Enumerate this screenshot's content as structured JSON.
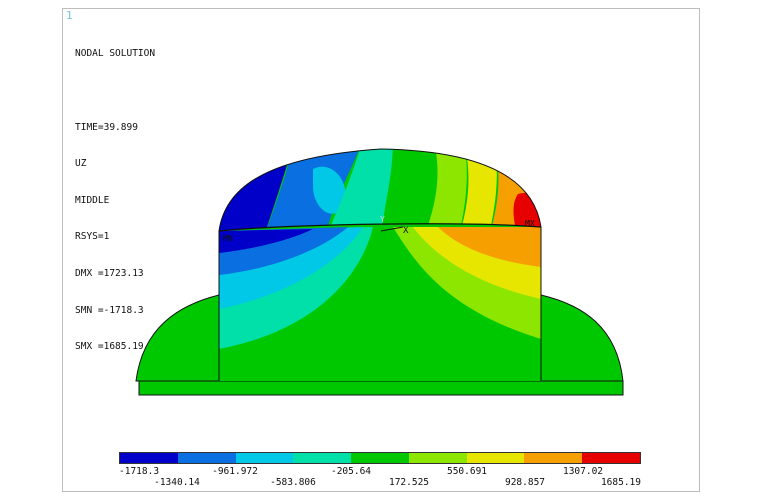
{
  "viewport": {
    "window_number": "1",
    "info_lines": [
      "NODAL SOLUTION",
      "",
      "TIME=39.899",
      "UZ",
      "MIDDLE",
      "RSYS=1",
      "DMX =1723.13",
      "SMN =-1718.3",
      "SMX =1685.19"
    ]
  },
  "model": {
    "markers": {
      "mn": "MN",
      "mx": "MX",
      "y_axis": "Y",
      "x_axis": "X"
    }
  },
  "legend": {
    "colors": [
      "#0000c8",
      "#0a6fe0",
      "#00c8e6",
      "#00e0a8",
      "#00c800",
      "#8ce600",
      "#e6e600",
      "#f5a000",
      "#e60000"
    ],
    "labels": [
      "-1718.3",
      "-1340.14",
      "-961.972",
      "-583.806",
      "-205.64",
      "172.525",
      "550.691",
      "928.857",
      "1307.02",
      "1685.19"
    ]
  }
}
